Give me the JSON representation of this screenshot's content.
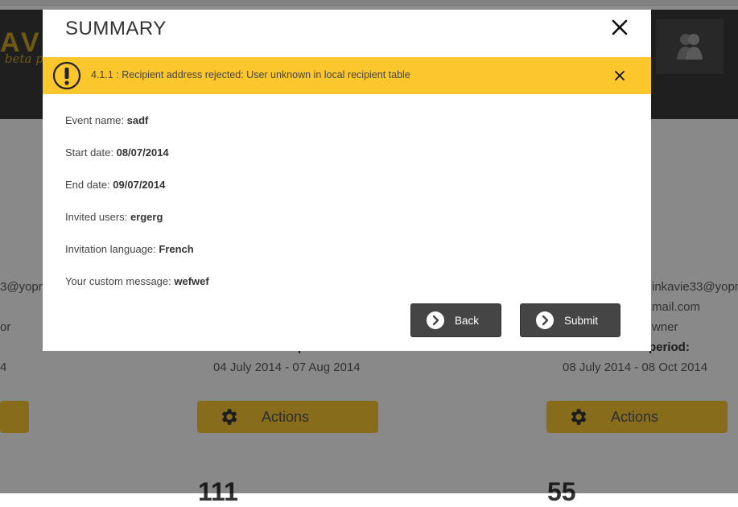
{
  "background": {
    "logo_fragment": "AV",
    "logo_sub": "beta pr",
    "left_card": {
      "email": "3@yopm",
      "role": "or",
      "dates": "4"
    },
    "middle_card": {
      "period_fragment": "p",
      "dates": "04 July 2014 - 07 Aug 2014",
      "actions_label": "Actions",
      "big_number": "111"
    },
    "right_card": {
      "email": "inkavie33@yopm",
      "email2": "mail.com",
      "role": "wner",
      "period_label": "period:",
      "dates": "08 July 2014 - 08 Oct 2014",
      "actions_label": "Actions",
      "big_number": "55"
    }
  },
  "modal": {
    "title": "SUMMARY",
    "alert": {
      "message": "4.1.1 : Recipient address rejected: User unknown in local recipient table",
      "color": "#fcc62d"
    },
    "fields": [
      {
        "label": "Event name: ",
        "value": "sadf"
      },
      {
        "label": "Start date: ",
        "value": "08/07/2014"
      },
      {
        "label": "End date: ",
        "value": "09/07/2014"
      },
      {
        "label": "Invited users: ",
        "value": "ergerg"
      },
      {
        "label": "Invitation language: ",
        "value": "French"
      },
      {
        "label": "Your custom message: ",
        "value": "wefwef"
      }
    ],
    "buttons": {
      "back_label": "Back",
      "submit_label": "Submit"
    }
  }
}
